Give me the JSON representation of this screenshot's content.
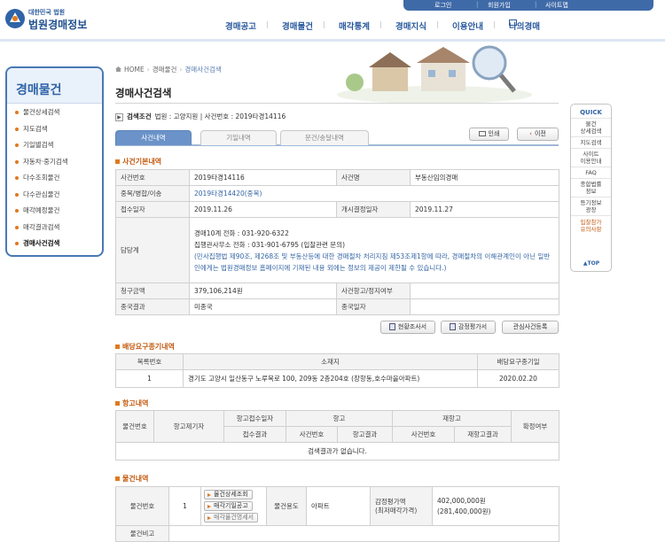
{
  "brand": {
    "line1": "대한민국 법원",
    "line2": "법원경매정보"
  },
  "util": {
    "login": "로그인",
    "join": "회원가입",
    "sitemap": "사이트맵"
  },
  "gnb": {
    "items": [
      "경매공고",
      "경매물건",
      "매각통계",
      "경매지식",
      "이용안내"
    ],
    "my": "나의경매"
  },
  "lnb": {
    "title": "경매물건",
    "items": [
      "물건상세검색",
      "지도검색",
      "기일별검색",
      "자동차·중기검색",
      "다수조회물건",
      "다수관심물건",
      "매각예정물건",
      "매각결과검색",
      "경매사건검색"
    ],
    "active_index": 8
  },
  "breadcrumb": {
    "home": "HOME",
    "level1": "경매물건",
    "current": "경매사건검색"
  },
  "page_title": "경매사건검색",
  "search_condition": {
    "label": "검색조건",
    "text": "법원 : 고양지원 | 사건번호 : 2019타경14116"
  },
  "tabs": [
    "사건내역",
    "기일내역",
    "문건/송달내역"
  ],
  "buttons": {
    "print": "인쇄",
    "prev": "이전",
    "survey": "현황조사서",
    "appraisal": "감정평가서",
    "register": "관심사건등록"
  },
  "case_info": {
    "section": "사건기본내역",
    "rows": [
      {
        "l1": "사건번호",
        "v1": "2019타경14116",
        "l2": "사건명",
        "v2": "부동산임의경매"
      },
      {
        "l1": "중복/병합/이송",
        "v1": "2019타경14420(중복)"
      },
      {
        "l1": "접수일자",
        "v1": "2019.11.26",
        "l2": "개시결정일자",
        "v2": "2019.11.27"
      },
      {
        "l1": "담당계",
        "v1a": "경매10계   전화 : 031-920-6322",
        "v1b": "집행관사무소   전화 : 031-901-6795 (입찰관련 문의)",
        "v1c": "(민사집행법 제90조, 제268조 및 부동산등에 대한 경매절차 처리지침 제53조제1항에 따라, 경매절차의 이해관계인이 아닌 일반인에게는 법원경매정보 홈페이지에 기재된 내용 외에는 정보의 제공이 제한될 수 있습니다.)"
      },
      {
        "l1": "청구금액",
        "v1": "379,106,214원",
        "l2": "사건항고/정지여부",
        "v2": ""
      },
      {
        "l1": "종국결과",
        "v1": "미종국",
        "l2": "종국일자",
        "v2": ""
      }
    ]
  },
  "dividend": {
    "section": "배당요구종기내역",
    "headers": [
      "목록번호",
      "소재지",
      "배당요구종기일"
    ],
    "row": {
      "no": "1",
      "address": "경기도 고양시 일산동구 노루목로 100, 209동 2층204호 (장항동,호수마을아파트)",
      "date": "2020.02.20"
    }
  },
  "appeal": {
    "section": "항고내역",
    "h": {
      "item_no": "물건번호",
      "appellant": "항고제기자",
      "app_date": "항고접수일자",
      "result": "접수결과",
      "appeal": "항고",
      "reappeal": "재항고",
      "case_no": "사건번호",
      "app_result": "항고결과",
      "re_case_no": "사건번호",
      "re_result": "재항고결과",
      "final": "확정여부"
    },
    "empty": "검색결과가 없습니다."
  },
  "items": {
    "section": "물건내역",
    "row": {
      "label": "물건번호",
      "no": "1",
      "btn1": "물건상세조회",
      "btn2": "매각기일공고",
      "btn3": "매각물건명세서",
      "usage_label": "물건용도",
      "usage": "아파트",
      "appr_label": "감정평가액\n(최저매각가격)",
      "appr": "402,000,000원",
      "min": "(281,400,000원)"
    },
    "remark_label": "물건비고"
  },
  "quick": {
    "title": "QUICK",
    "items": [
      "물건\n상세검색",
      "지도검색",
      "사이트\n이용안내",
      "FAQ",
      "종합법률\n정보",
      "등기정보\n광장"
    ],
    "notice": "입찰참가\n유의사항",
    "top": "TOP"
  }
}
